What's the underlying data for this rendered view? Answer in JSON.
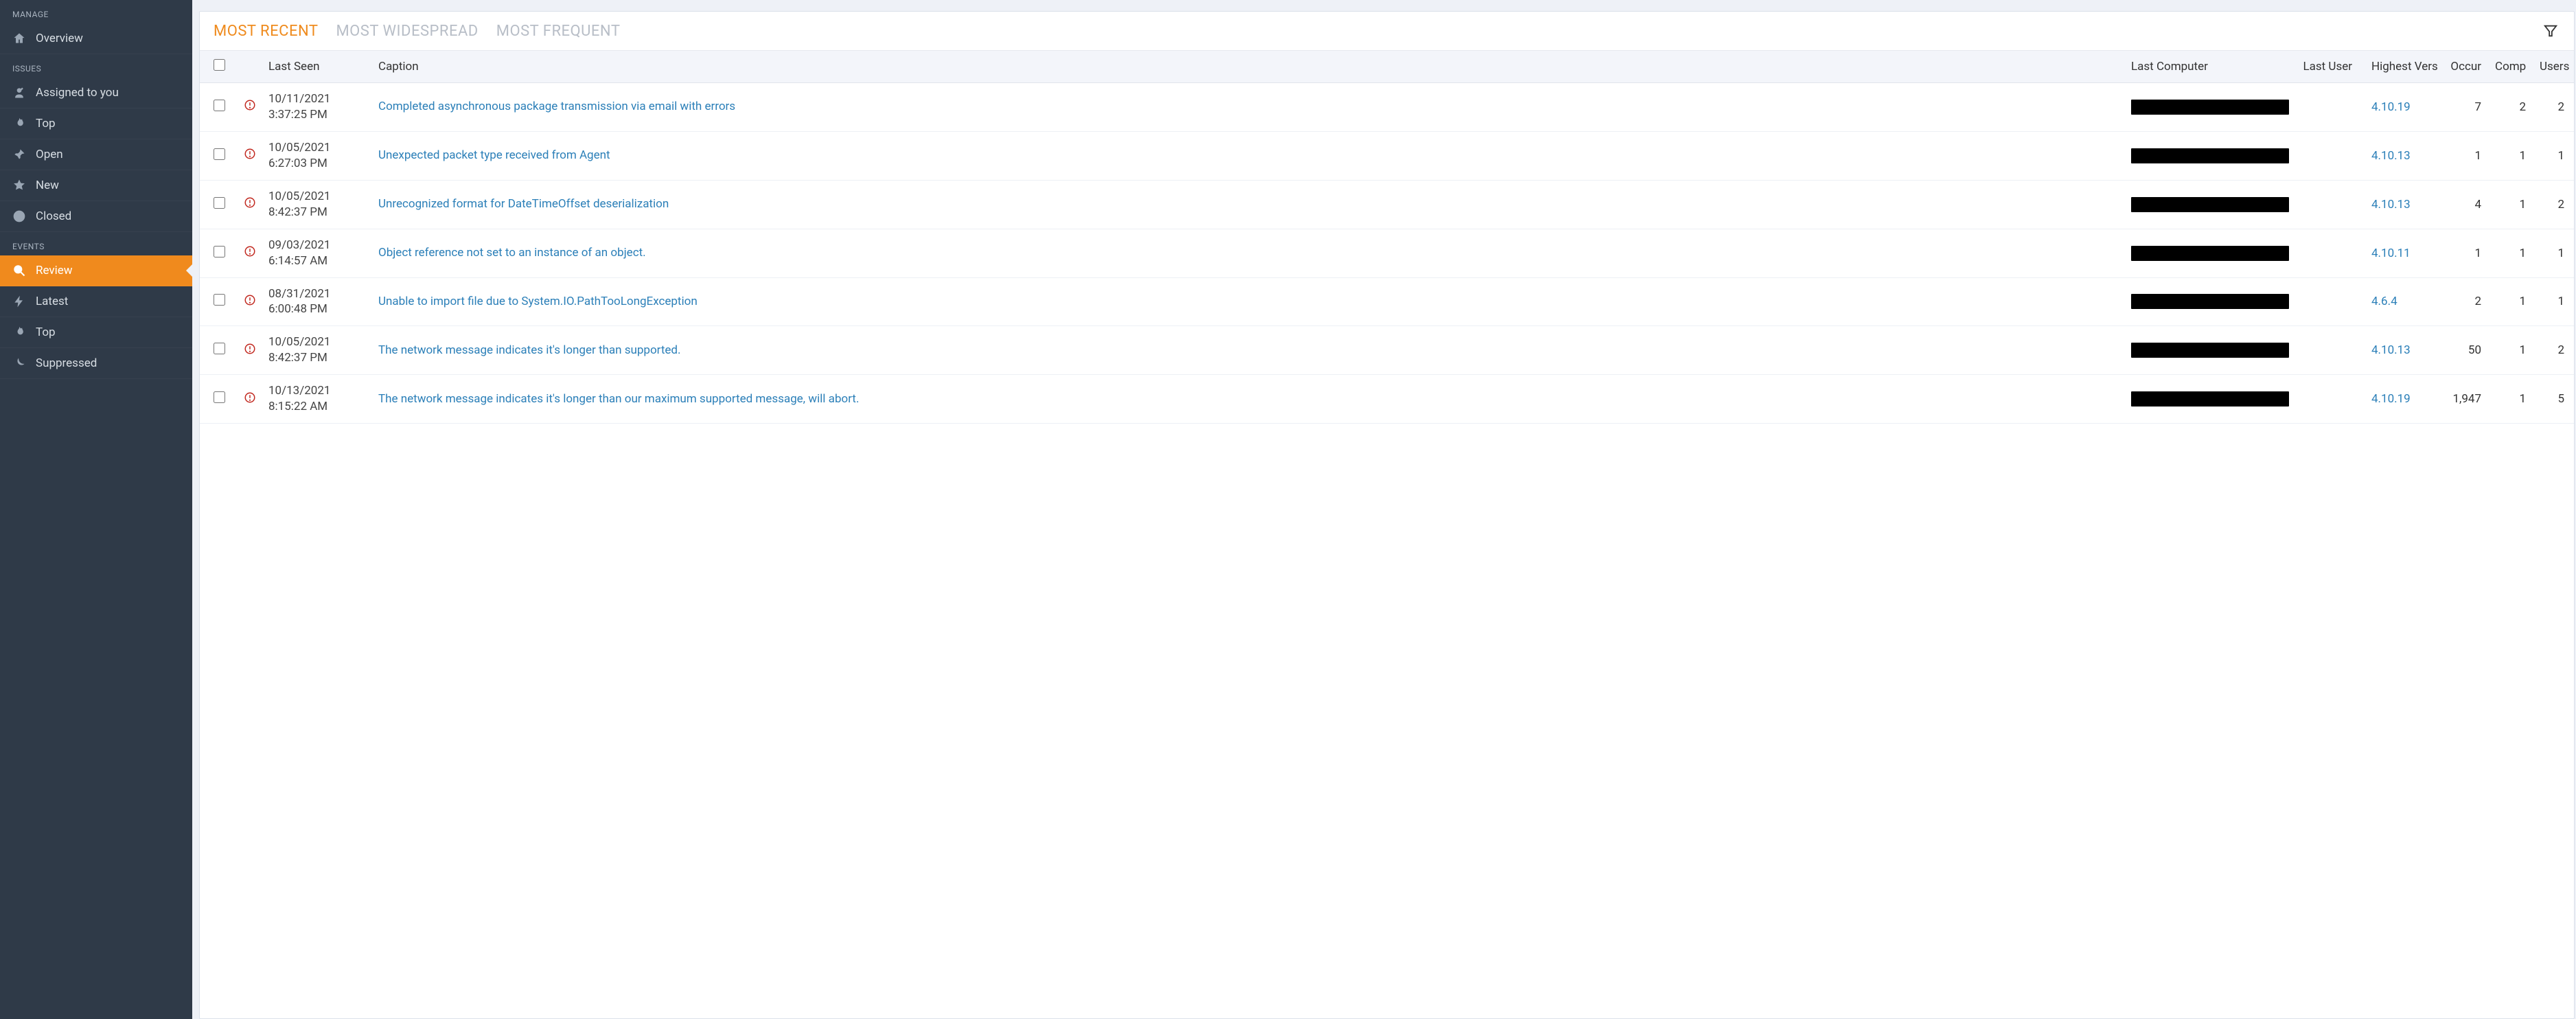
{
  "sidebar": {
    "sections": [
      {
        "header": "MANAGE",
        "items": [
          {
            "key": "overview",
            "label": "Overview",
            "icon": "home-icon",
            "active": false
          }
        ]
      },
      {
        "header": "ISSUES",
        "items": [
          {
            "key": "assigned",
            "label": "Assigned to you",
            "icon": "user-assigned-icon",
            "active": false
          },
          {
            "key": "issues-top",
            "label": "Top",
            "icon": "flame-icon",
            "active": false
          },
          {
            "key": "open",
            "label": "Open",
            "icon": "pin-icon",
            "active": false
          },
          {
            "key": "new",
            "label": "New",
            "icon": "star-icon",
            "active": false
          },
          {
            "key": "closed",
            "label": "Closed",
            "icon": "prohibit-icon",
            "active": false
          }
        ]
      },
      {
        "header": "EVENTS",
        "items": [
          {
            "key": "review",
            "label": "Review",
            "icon": "search-icon",
            "active": true
          },
          {
            "key": "latest",
            "label": "Latest",
            "icon": "bolt-icon",
            "active": false
          },
          {
            "key": "events-top",
            "label": "Top",
            "icon": "flame-icon",
            "active": false
          },
          {
            "key": "suppressed",
            "label": "Suppressed",
            "icon": "moon-icon",
            "active": false
          }
        ]
      }
    ]
  },
  "tabs": [
    {
      "key": "recent",
      "label": "MOST RECENT",
      "active": true
    },
    {
      "key": "widespread",
      "label": "MOST WIDESPREAD",
      "active": false
    },
    {
      "key": "frequent",
      "label": "MOST FREQUENT",
      "active": false
    }
  ],
  "table": {
    "columns": {
      "last_seen": "Last Seen",
      "caption": "Caption",
      "last_computer": "Last Computer",
      "last_user": "Last User",
      "highest_version": "Highest Vers",
      "occurrences": "Occur",
      "computers": "Comp",
      "users": "Users"
    },
    "rows": [
      {
        "date": "10/11/2021",
        "time": "3:37:25 PM",
        "caption": "Completed asynchronous package transmission via email with errors",
        "version": "4.10.19",
        "occur": "7",
        "computers": "2",
        "users": "2"
      },
      {
        "date": "10/05/2021",
        "time": "6:27:03 PM",
        "caption": "Unexpected packet type received from Agent",
        "version": "4.10.13",
        "occur": "1",
        "computers": "1",
        "users": "1"
      },
      {
        "date": "10/05/2021",
        "time": "8:42:37 PM",
        "caption": "Unrecognized format for DateTimeOffset deserialization",
        "version": "4.10.13",
        "occur": "4",
        "computers": "1",
        "users": "2"
      },
      {
        "date": "09/03/2021",
        "time": "6:14:57 AM",
        "caption": "Object reference not set to an instance of an object.",
        "version": "4.10.11",
        "occur": "1",
        "computers": "1",
        "users": "1"
      },
      {
        "date": "08/31/2021",
        "time": "6:00:48 PM",
        "caption": "Unable to import file due to System.IO.PathTooLongException",
        "version": "4.6.4",
        "occur": "2",
        "computers": "1",
        "users": "1"
      },
      {
        "date": "10/05/2021",
        "time": "8:42:37 PM",
        "caption": "The network message indicates it's longer than supported.",
        "version": "4.10.13",
        "occur": "50",
        "computers": "1",
        "users": "2"
      },
      {
        "date": "10/13/2021",
        "time": "8:15:22 AM",
        "caption": "The network message indicates it's longer than our maximum supported message, will abort.",
        "version": "4.10.19",
        "occur": "1,947",
        "computers": "1",
        "users": "5"
      }
    ]
  }
}
